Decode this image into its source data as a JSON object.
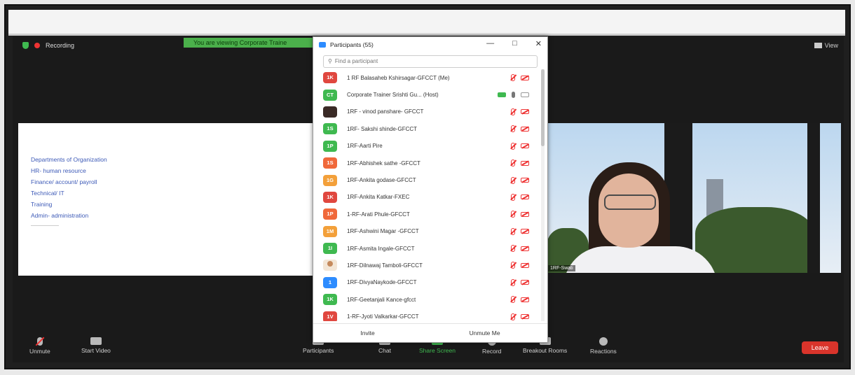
{
  "meeting": {
    "recording_label": "Recording",
    "banner_text": "You are viewing Corporate Traine",
    "view_label": "View"
  },
  "slide": {
    "items": [
      "Departments of Organization",
      "HR- human resource",
      "Finance/ account/ payroll",
      "Technical/ IT",
      "Training",
      "Admin- administration"
    ]
  },
  "video": {
    "name_tag": "1RF-Swati"
  },
  "participants_panel": {
    "title": "Participants (55)",
    "search_placeholder": "Find a participant",
    "participants": [
      {
        "initials": "1K",
        "color": "#e0473f",
        "name": "1 RF Balasaheb Kshirsagar-GFCCT (Me)",
        "status": "muted"
      },
      {
        "initials": "CT",
        "color": "#3fb950",
        "name": "Corporate Trainer Srishti Gu... (Host)",
        "status": "host"
      },
      {
        "initials": "",
        "color": "#3a2a26",
        "name": "1RF - vinod  panshare-  GFCCT",
        "status": "muted",
        "avatar": "photo"
      },
      {
        "initials": "1S",
        "color": "#3fb950",
        "name": "1RF- Sakshi shinde-GFCCT",
        "status": "muted"
      },
      {
        "initials": "1P",
        "color": "#3fb950",
        "name": "1RF-Aarti Pire",
        "status": "muted"
      },
      {
        "initials": "1S",
        "color": "#f0683a",
        "name": "1RF-Abhishek sathe -GFCCT",
        "status": "muted"
      },
      {
        "initials": "1G",
        "color": "#f3a03a",
        "name": "1RF-Ankita godase-GFCCT",
        "status": "muted"
      },
      {
        "initials": "1K",
        "color": "#e0473f",
        "name": "1RF-Ankita Katkar-FXEC",
        "status": "muted"
      },
      {
        "initials": "1P",
        "color": "#f0683a",
        "name": "1-RF-Arati Phule-GFCCT",
        "status": "muted"
      },
      {
        "initials": "1M",
        "color": "#f3a03a",
        "name": "1RF-Ashwini Magar -GFCCT",
        "status": "muted"
      },
      {
        "initials": "1I",
        "color": "#3fb950",
        "name": "1RF-Asmita Ingale-GFCCT",
        "status": "muted"
      },
      {
        "initials": "",
        "color": "#f3e6d6",
        "name": "1RF-Dilnawaj Tamboli-GFCCT",
        "status": "muted",
        "avatar": "face"
      },
      {
        "initials": "1",
        "color": "#2d8cff",
        "name": "1RF-DivyaNaykode-GFCCT",
        "status": "muted"
      },
      {
        "initials": "1K",
        "color": "#3fb950",
        "name": "1RF-Geetanjali Kance-gfcct",
        "status": "muted"
      },
      {
        "initials": "1V",
        "color": "#e0473f",
        "name": "1-RF-Jyoti Valkarkar-GFCCT",
        "status": "muted"
      }
    ],
    "invite_label": "Invite",
    "unmute_me_label": "Unmute Me"
  },
  "toolbar": {
    "unmute": "Unmute",
    "start_video": "Start Video",
    "participants": "Participants",
    "chat": "Chat",
    "share_screen": "Share Screen",
    "record": "Record",
    "breakout_rooms": "Breakout Rooms",
    "reactions": "Reactions",
    "leave": "Leave"
  }
}
